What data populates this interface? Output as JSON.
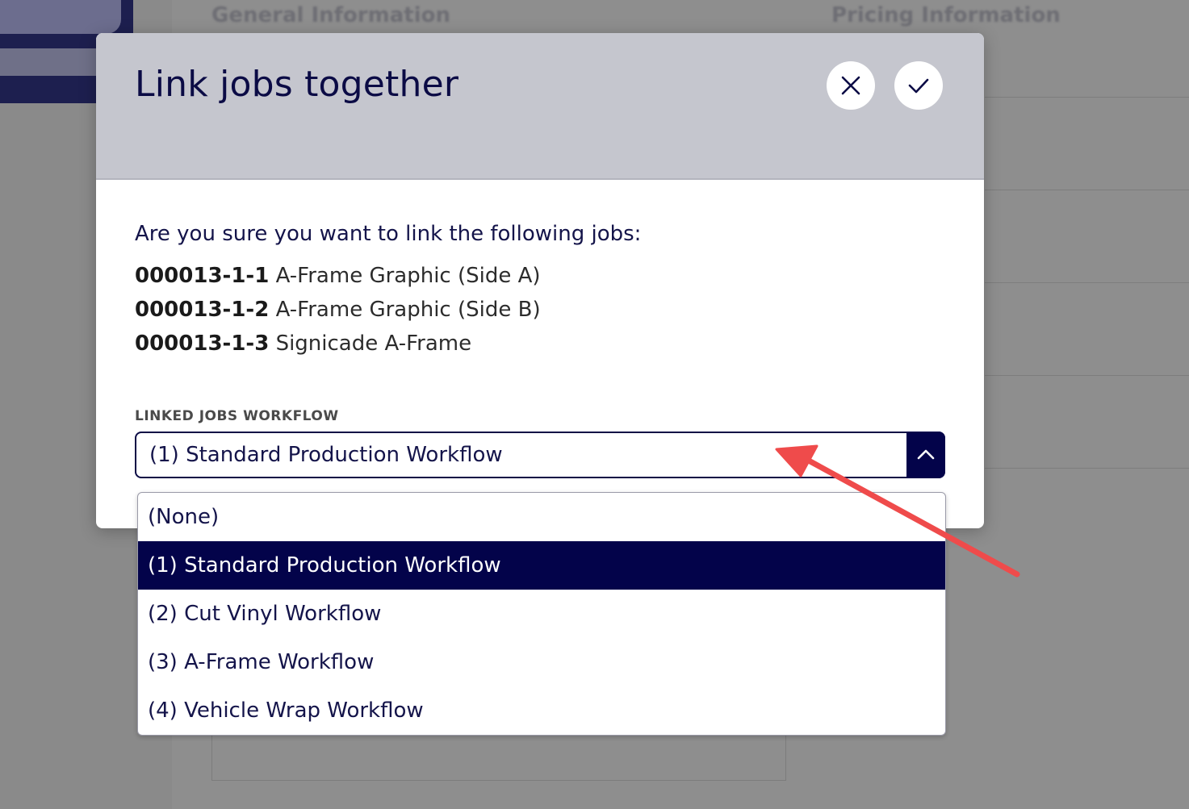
{
  "modal": {
    "title": "Link jobs together",
    "close_icon": "close-icon",
    "confirm_icon": "check-icon",
    "prompt": "Are you sure you want to link the following jobs:",
    "jobs": [
      {
        "id": "000013-1-1",
        "name": "A-Frame Graphic (Side A)"
      },
      {
        "id": "000013-1-2",
        "name": "A-Frame Graphic (Side B)"
      },
      {
        "id": "000013-1-3",
        "name": "Signicade A-Frame"
      }
    ],
    "workflow_field": {
      "label": "LINKED JOBS WORKFLOW",
      "value": "(1) Standard Production Workflow",
      "toggle_icon": "chevron-up-icon"
    }
  },
  "dropdown": {
    "options": [
      "(None)",
      "(1) Standard Production Workflow",
      "(2) Cut Vinyl Workflow",
      "(3) A-Frame Workflow",
      "(4) Vehicle Wrap Workflow"
    ],
    "selected_index": 1
  },
  "colors": {
    "brand_navy": "#03034a",
    "header_bg": "#c5c6ce",
    "annotation_arrow": "#ef4b4b"
  }
}
